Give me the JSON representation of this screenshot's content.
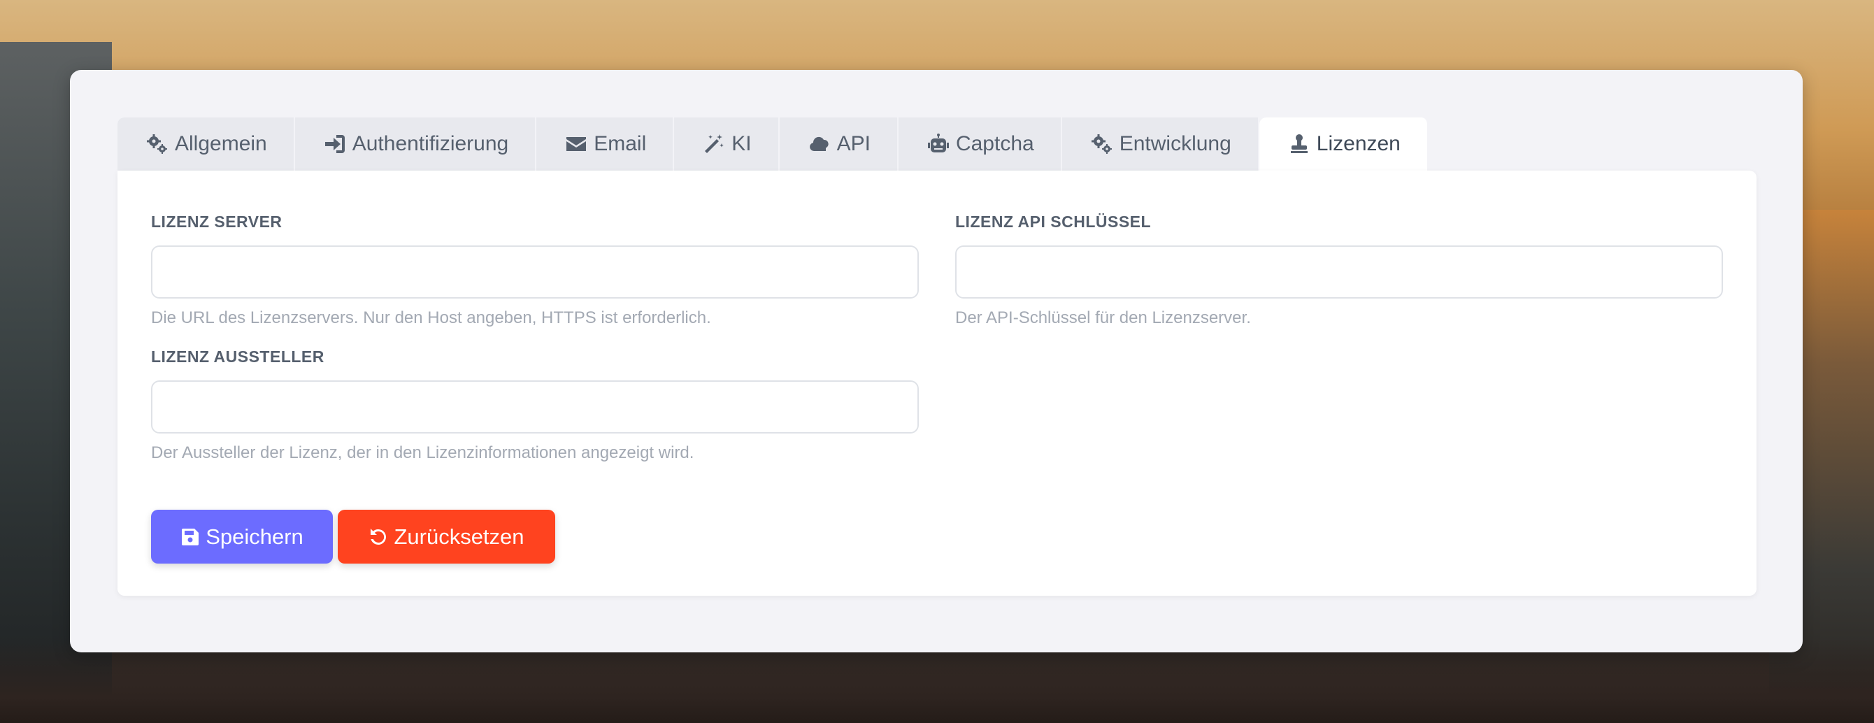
{
  "tabs": [
    {
      "label": "Allgemein",
      "icon": "gears-icon",
      "active": false
    },
    {
      "label": "Authentifizierung",
      "icon": "sign-in-icon",
      "active": false
    },
    {
      "label": "Email",
      "icon": "envelope-icon",
      "active": false
    },
    {
      "label": "KI",
      "icon": "magic-wand-icon",
      "active": false
    },
    {
      "label": "API",
      "icon": "cloud-icon",
      "active": false
    },
    {
      "label": "Captcha",
      "icon": "robot-icon",
      "active": false
    },
    {
      "label": "Entwicklung",
      "icon": "gears-icon",
      "active": false
    },
    {
      "label": "Lizenzen",
      "icon": "stamp-icon",
      "active": true
    }
  ],
  "form": {
    "license_server": {
      "label": "LIZENZ SERVER",
      "value": "",
      "help": "Die URL des Lizenzservers. Nur den Host angeben, HTTPS ist erforderlich."
    },
    "license_api_key": {
      "label": "LIZENZ API SCHLÜSSEL",
      "value": "",
      "help": "Der API-Schlüssel für den Lizenzserver."
    },
    "license_issuer": {
      "label": "LIZENZ AUSSTELLER",
      "value": "",
      "help": "Der Aussteller der Lizenz, der in den Lizenzinformationen angezeigt wird."
    }
  },
  "actions": {
    "save_label": "Speichern",
    "reset_label": "Zurücksetzen"
  },
  "colors": {
    "save": "#6c6cff",
    "reset": "#ff431f"
  }
}
